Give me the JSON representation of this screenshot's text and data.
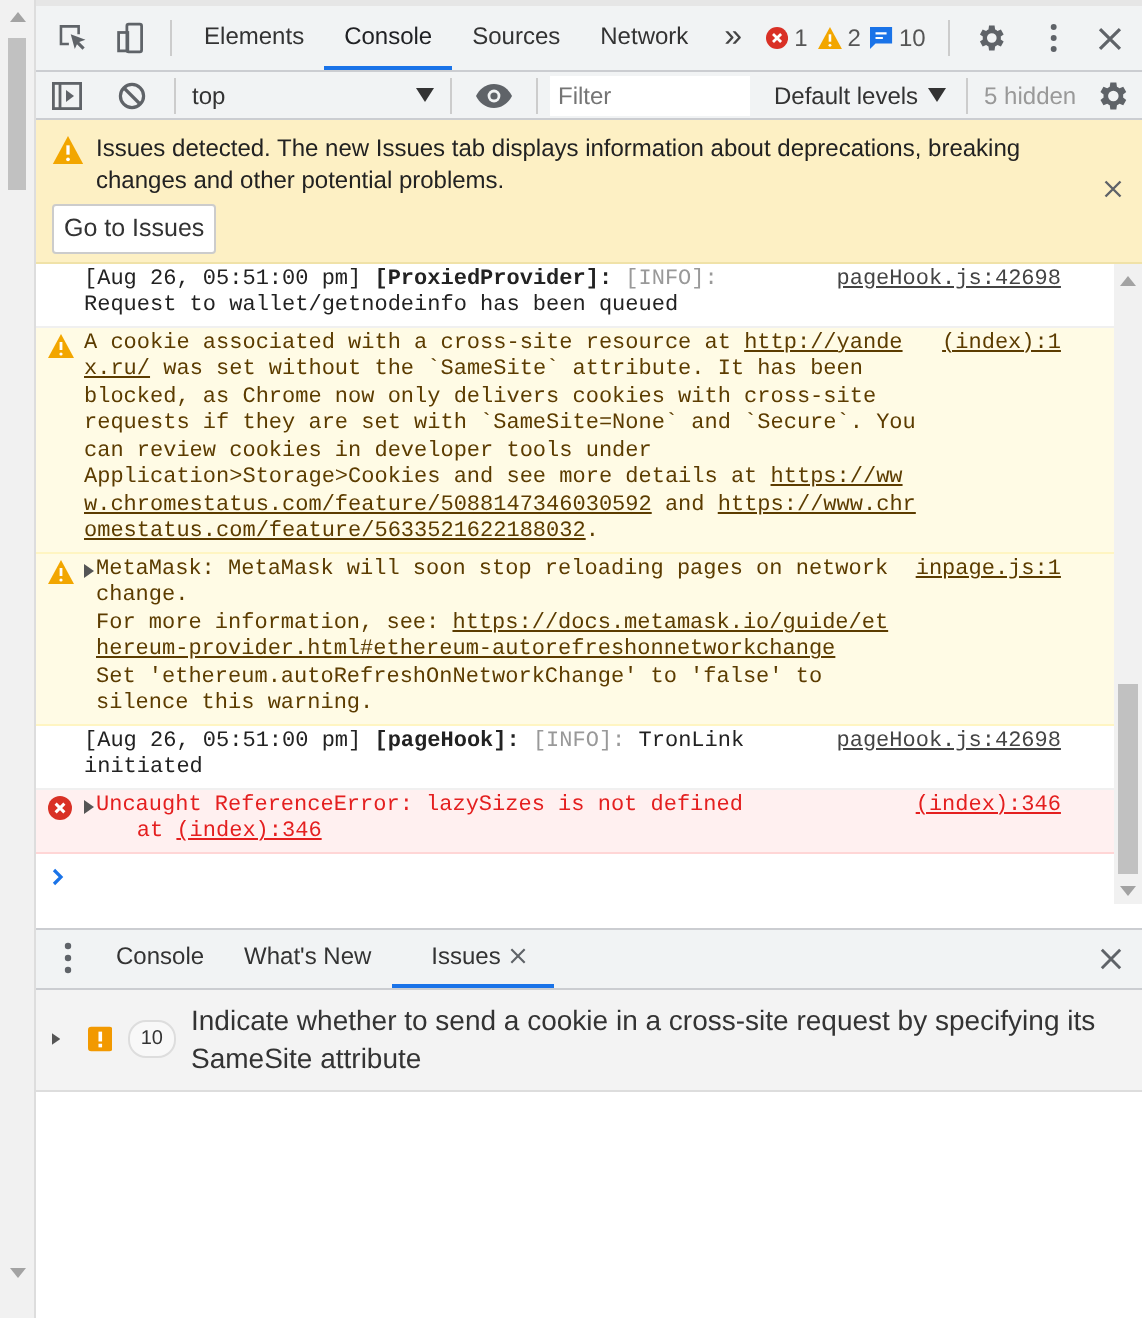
{
  "toolbar": {
    "tabs": [
      {
        "label": "Elements",
        "selected": false
      },
      {
        "label": "Console",
        "selected": true
      },
      {
        "label": "Sources",
        "selected": false
      },
      {
        "label": "Network",
        "selected": false
      }
    ],
    "more": "»",
    "counts": [
      {
        "kind": "error",
        "count": "1"
      },
      {
        "kind": "warning",
        "count": "2"
      },
      {
        "kind": "info",
        "count": "10"
      }
    ]
  },
  "console_toolbar": {
    "context": "top",
    "filter": {
      "placeholder": "Filter"
    },
    "levels": "Default levels",
    "hidden": "5 hidden"
  },
  "banner": {
    "text": "Issues detected. The new Issues tab displays information about deprecations, breaking changes and other potential problems.",
    "button": "Go to Issues"
  },
  "messages": [
    {
      "kind": "log",
      "source": "pageHook.js:42698",
      "parts": [
        {
          "kind": "text",
          "text": "[Aug 26, 05:51:00 pm] "
        },
        {
          "kind": "bold",
          "text": "[ProxiedProvider]: "
        },
        {
          "kind": "dim",
          "text": "[INFO]:"
        },
        {
          "kind": "text",
          "text": " Request to wallet/getnodeinfo has been queued"
        }
      ]
    },
    {
      "kind": "warning",
      "source": "(index):1",
      "parts": [
        {
          "kind": "text",
          "text": "A cookie associated with a cross-site resource at "
        },
        {
          "kind": "link",
          "text": "http://yandex.ru/"
        },
        {
          "kind": "text",
          "text": " was set without the `SameSite` attribute. It has been blocked, as Chrome now only delivers cookies with cross-site requests if they are set with `SameSite=None` and `Secure`. You can review cookies in developer tools under Application>Storage>Cookies and see more details at "
        },
        {
          "kind": "link",
          "text": "https://www.chromestatus.com/feature/5088147346030592"
        },
        {
          "kind": "text",
          "text": " and "
        },
        {
          "kind": "link",
          "text": "https://www.chromestatus.com/feature/5633521622188032"
        },
        {
          "kind": "text",
          "text": "."
        }
      ]
    },
    {
      "kind": "warning",
      "source": "inpage.js:1",
      "expanded": false,
      "parts": [
        {
          "kind": "text",
          "text": "MetaMask: MetaMask will soon stop reloading pages on network change.\nFor more information, see: "
        },
        {
          "kind": "link",
          "text": "https://docs.metamask.io/guide/ethereum-provider.html#ethereum-autorefreshonnetworkchange"
        },
        {
          "kind": "text",
          "text": "\nSet 'ethereum.autoRefreshOnNetworkChange' to 'false' to silence this warning."
        }
      ]
    },
    {
      "kind": "log",
      "source": "pageHook.js:42698",
      "parts": [
        {
          "kind": "text",
          "text": "[Aug 26, 05:51:00 pm] "
        },
        {
          "kind": "bold",
          "text": "[pageHook]: "
        },
        {
          "kind": "dim",
          "text": "[INFO]:"
        },
        {
          "kind": "text",
          "text": " TronLink initiated"
        }
      ]
    },
    {
      "kind": "error",
      "source": "(index):346",
      "expanded": false,
      "parts": [
        {
          "kind": "text",
          "text": "Uncaught ReferenceError: lazySizes is not defined"
        }
      ],
      "stack": [
        {
          "kind": "text",
          "text": "at "
        },
        {
          "kind": "link",
          "text": "(index):346"
        }
      ]
    }
  ],
  "drawer": {
    "tabs": [
      {
        "label": "Console",
        "selected": false,
        "closable": false
      },
      {
        "label": "What's New",
        "selected": false,
        "closable": false
      },
      {
        "label": "Issues",
        "selected": true,
        "closable": true
      }
    ]
  },
  "issues": [
    {
      "expanded": false,
      "count": "10",
      "text": "Indicate whether to send a cookie in a cross-site request by specifying its SameSite attribute"
    }
  ]
}
